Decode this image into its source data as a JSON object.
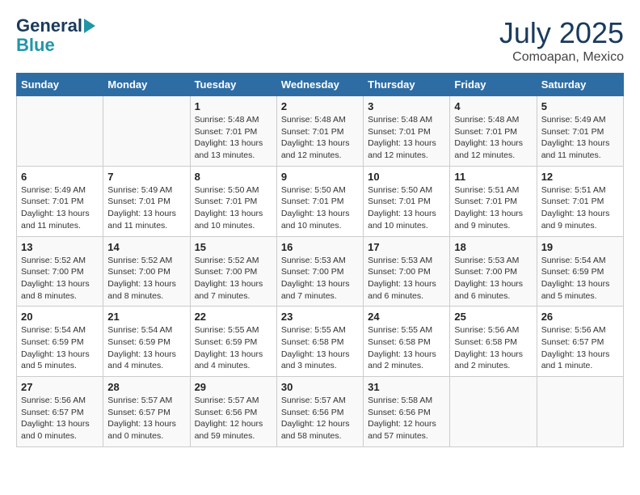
{
  "header": {
    "logo_line1": "General",
    "logo_line2": "Blue",
    "month": "July 2025",
    "location": "Comoapan, Mexico"
  },
  "weekdays": [
    "Sunday",
    "Monday",
    "Tuesday",
    "Wednesday",
    "Thursday",
    "Friday",
    "Saturday"
  ],
  "weeks": [
    [
      {
        "day": "",
        "info": ""
      },
      {
        "day": "",
        "info": ""
      },
      {
        "day": "1",
        "info": "Sunrise: 5:48 AM\nSunset: 7:01 PM\nDaylight: 13 hours and 13 minutes."
      },
      {
        "day": "2",
        "info": "Sunrise: 5:48 AM\nSunset: 7:01 PM\nDaylight: 13 hours and 12 minutes."
      },
      {
        "day": "3",
        "info": "Sunrise: 5:48 AM\nSunset: 7:01 PM\nDaylight: 13 hours and 12 minutes."
      },
      {
        "day": "4",
        "info": "Sunrise: 5:48 AM\nSunset: 7:01 PM\nDaylight: 13 hours and 12 minutes."
      },
      {
        "day": "5",
        "info": "Sunrise: 5:49 AM\nSunset: 7:01 PM\nDaylight: 13 hours and 11 minutes."
      }
    ],
    [
      {
        "day": "6",
        "info": "Sunrise: 5:49 AM\nSunset: 7:01 PM\nDaylight: 13 hours and 11 minutes."
      },
      {
        "day": "7",
        "info": "Sunrise: 5:49 AM\nSunset: 7:01 PM\nDaylight: 13 hours and 11 minutes."
      },
      {
        "day": "8",
        "info": "Sunrise: 5:50 AM\nSunset: 7:01 PM\nDaylight: 13 hours and 10 minutes."
      },
      {
        "day": "9",
        "info": "Sunrise: 5:50 AM\nSunset: 7:01 PM\nDaylight: 13 hours and 10 minutes."
      },
      {
        "day": "10",
        "info": "Sunrise: 5:50 AM\nSunset: 7:01 PM\nDaylight: 13 hours and 10 minutes."
      },
      {
        "day": "11",
        "info": "Sunrise: 5:51 AM\nSunset: 7:01 PM\nDaylight: 13 hours and 9 minutes."
      },
      {
        "day": "12",
        "info": "Sunrise: 5:51 AM\nSunset: 7:01 PM\nDaylight: 13 hours and 9 minutes."
      }
    ],
    [
      {
        "day": "13",
        "info": "Sunrise: 5:52 AM\nSunset: 7:00 PM\nDaylight: 13 hours and 8 minutes."
      },
      {
        "day": "14",
        "info": "Sunrise: 5:52 AM\nSunset: 7:00 PM\nDaylight: 13 hours and 8 minutes."
      },
      {
        "day": "15",
        "info": "Sunrise: 5:52 AM\nSunset: 7:00 PM\nDaylight: 13 hours and 7 minutes."
      },
      {
        "day": "16",
        "info": "Sunrise: 5:53 AM\nSunset: 7:00 PM\nDaylight: 13 hours and 7 minutes."
      },
      {
        "day": "17",
        "info": "Sunrise: 5:53 AM\nSunset: 7:00 PM\nDaylight: 13 hours and 6 minutes."
      },
      {
        "day": "18",
        "info": "Sunrise: 5:53 AM\nSunset: 7:00 PM\nDaylight: 13 hours and 6 minutes."
      },
      {
        "day": "19",
        "info": "Sunrise: 5:54 AM\nSunset: 6:59 PM\nDaylight: 13 hours and 5 minutes."
      }
    ],
    [
      {
        "day": "20",
        "info": "Sunrise: 5:54 AM\nSunset: 6:59 PM\nDaylight: 13 hours and 5 minutes."
      },
      {
        "day": "21",
        "info": "Sunrise: 5:54 AM\nSunset: 6:59 PM\nDaylight: 13 hours and 4 minutes."
      },
      {
        "day": "22",
        "info": "Sunrise: 5:55 AM\nSunset: 6:59 PM\nDaylight: 13 hours and 4 minutes."
      },
      {
        "day": "23",
        "info": "Sunrise: 5:55 AM\nSunset: 6:58 PM\nDaylight: 13 hours and 3 minutes."
      },
      {
        "day": "24",
        "info": "Sunrise: 5:55 AM\nSunset: 6:58 PM\nDaylight: 13 hours and 2 minutes."
      },
      {
        "day": "25",
        "info": "Sunrise: 5:56 AM\nSunset: 6:58 PM\nDaylight: 13 hours and 2 minutes."
      },
      {
        "day": "26",
        "info": "Sunrise: 5:56 AM\nSunset: 6:57 PM\nDaylight: 13 hours and 1 minute."
      }
    ],
    [
      {
        "day": "27",
        "info": "Sunrise: 5:56 AM\nSunset: 6:57 PM\nDaylight: 13 hours and 0 minutes."
      },
      {
        "day": "28",
        "info": "Sunrise: 5:57 AM\nSunset: 6:57 PM\nDaylight: 13 hours and 0 minutes."
      },
      {
        "day": "29",
        "info": "Sunrise: 5:57 AM\nSunset: 6:56 PM\nDaylight: 12 hours and 59 minutes."
      },
      {
        "day": "30",
        "info": "Sunrise: 5:57 AM\nSunset: 6:56 PM\nDaylight: 12 hours and 58 minutes."
      },
      {
        "day": "31",
        "info": "Sunrise: 5:58 AM\nSunset: 6:56 PM\nDaylight: 12 hours and 57 minutes."
      },
      {
        "day": "",
        "info": ""
      },
      {
        "day": "",
        "info": ""
      }
    ]
  ]
}
